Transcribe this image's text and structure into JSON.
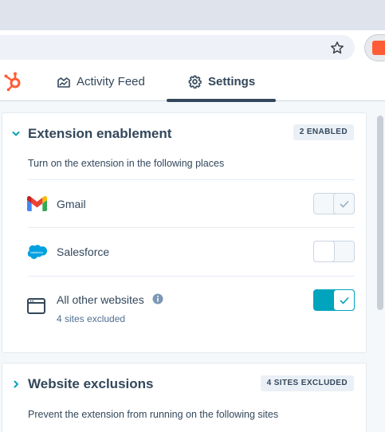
{
  "tabs": [
    {
      "label": "Activity Feed",
      "active": false
    },
    {
      "label": "Settings",
      "active": true
    }
  ],
  "enablement": {
    "title": "Extension enablement",
    "badge": "2 ENABLED",
    "description": "Turn on the extension in the following places",
    "rows": [
      {
        "label": "Gmail",
        "icon": "gmail-icon",
        "state": "on-disabled"
      },
      {
        "label": "Salesforce",
        "icon": "salesforce-icon",
        "state": "off"
      },
      {
        "label": "All other websites",
        "sublabel": "4 sites excluded",
        "icon": "browser-window-icon",
        "state": "on"
      }
    ]
  },
  "exclusions": {
    "title": "Website exclusions",
    "badge": "4 SITES EXCLUDED",
    "description": "Prevent the extension from running on the following sites"
  },
  "colors": {
    "accent": "#00a4bd",
    "brand": "#ff5c35",
    "text": "#33475b"
  }
}
